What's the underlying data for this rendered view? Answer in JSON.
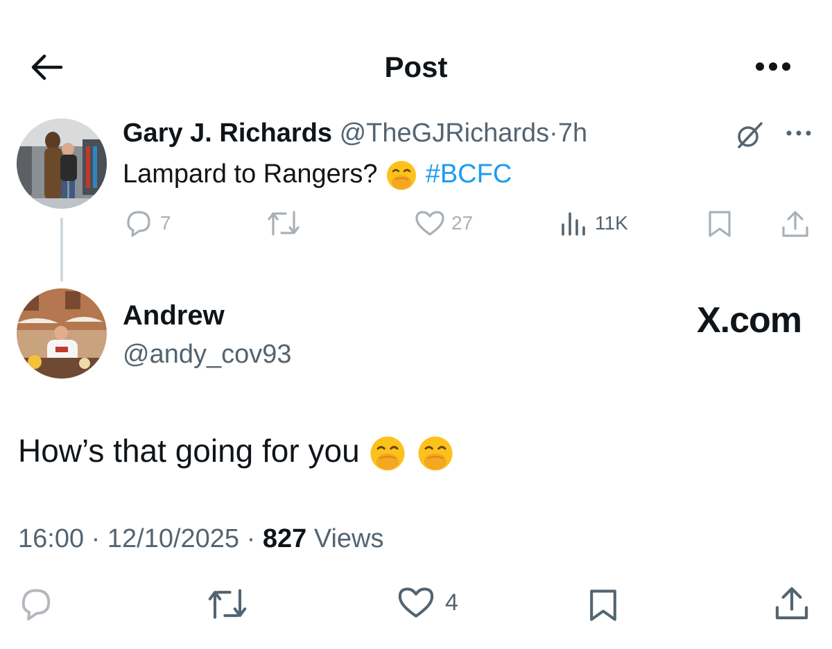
{
  "header": {
    "title": "Post"
  },
  "parent_post": {
    "author_name": "Gary J. Richards",
    "handle": "@TheGJRichards",
    "separator": "·",
    "time": "7h",
    "text": "Lampard to Rangers?",
    "hashtag": "#BCFC",
    "replies": "7",
    "likes": "27",
    "views": "11K"
  },
  "post": {
    "author_name": "Andrew",
    "handle": "@andy_cov93",
    "watermark": "X.com",
    "text": "How’s that going for you",
    "time": "16:00",
    "date": "12/10/2025",
    "separator": "·",
    "views_count": "827",
    "views_label": "Views",
    "likes": "4"
  },
  "colors": {
    "accent": "#1d9bf0",
    "text": "#0f1419",
    "secondary": "#536471"
  },
  "icons": [
    "back-arrow-icon",
    "more-icon",
    "grok-icon",
    "reply-icon",
    "retweet-icon",
    "like-icon",
    "views-icon",
    "bookmark-icon",
    "share-icon",
    "hand-over-mouth-emoji"
  ]
}
